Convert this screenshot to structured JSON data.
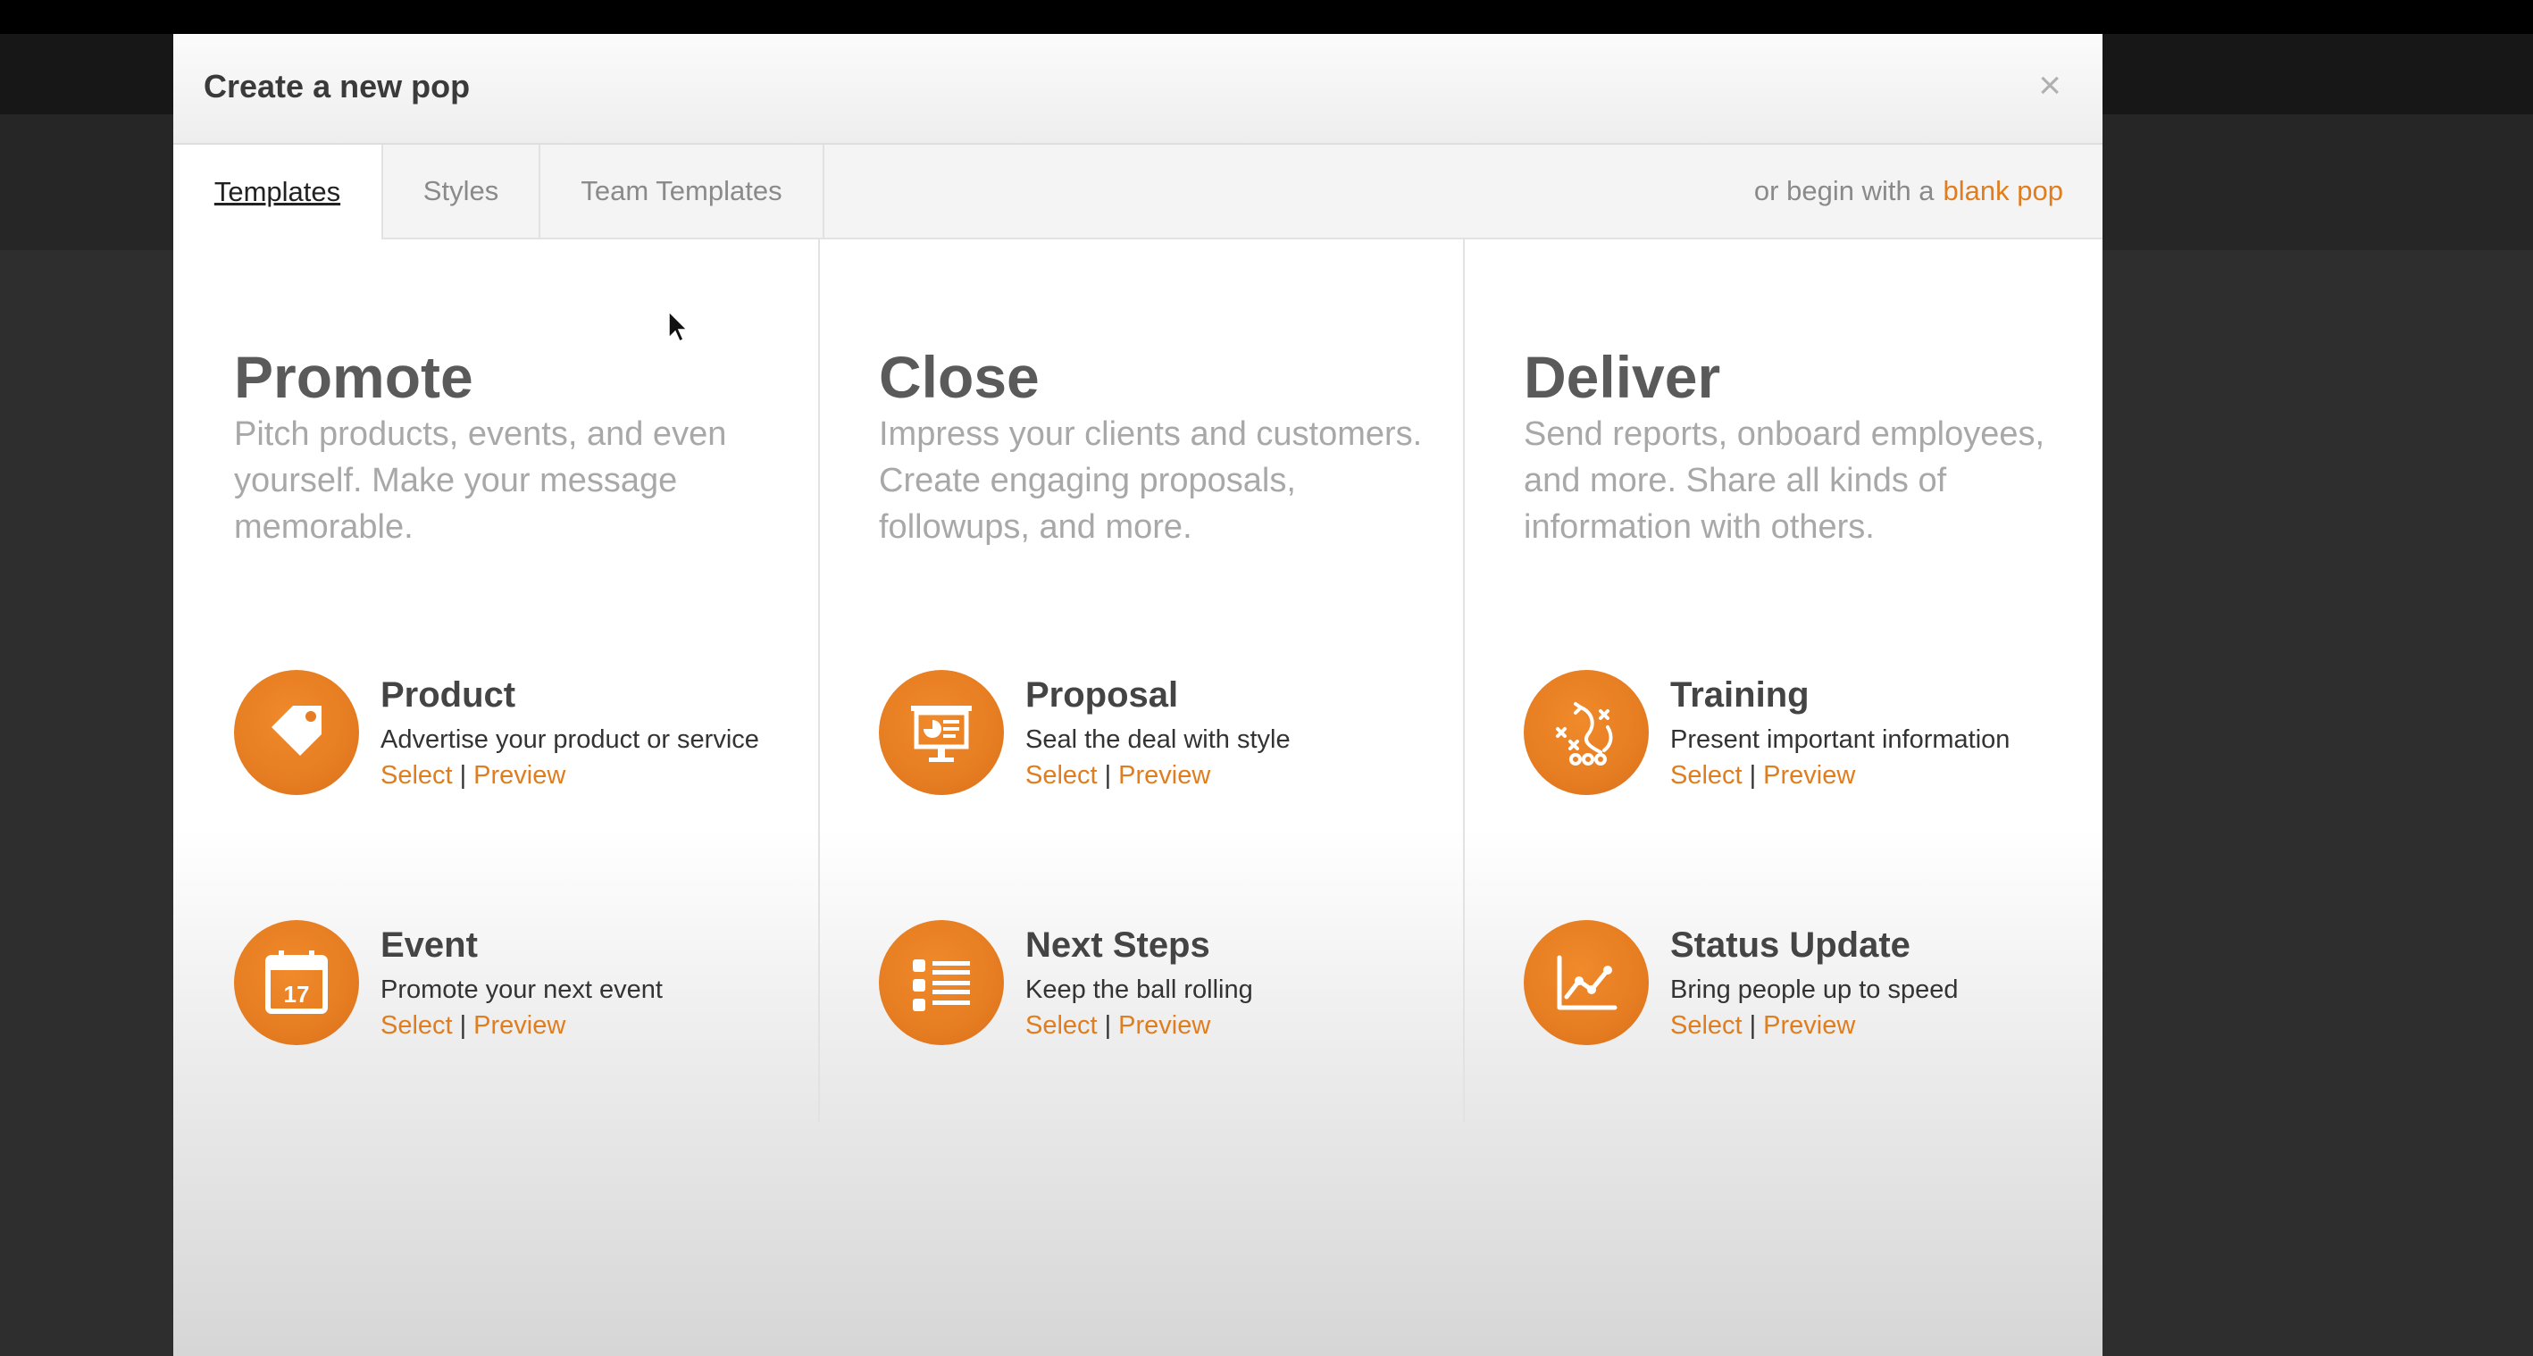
{
  "modal": {
    "title": "Create a new pop",
    "close": "×"
  },
  "tabs": [
    {
      "label": "Templates",
      "active": true
    },
    {
      "label": "Styles",
      "active": false
    },
    {
      "label": "Team Templates",
      "active": false
    }
  ],
  "blank": {
    "prefix": "or begin with a",
    "link": "blank pop"
  },
  "accent_color": "#e67d22",
  "columns": [
    {
      "title": "Promote",
      "description": "Pitch products, events, and even yourself. Make your message memorable.",
      "items": [
        {
          "icon": "tag-icon",
          "title": "Product",
          "desc": "Advertise your product or service",
          "select": "Select",
          "sep": "|",
          "preview": "Preview"
        },
        {
          "icon": "calendar-icon",
          "badge_text": "17",
          "title": "Event",
          "desc": "Promote your next event",
          "select": "Select",
          "sep": "|",
          "preview": "Preview"
        }
      ]
    },
    {
      "title": "Close",
      "description": "Impress your clients and customers. Create engaging proposals, followups, and more.",
      "items": [
        {
          "icon": "presentation-icon",
          "title": "Proposal",
          "desc": "Seal the deal with style",
          "select": "Select",
          "sep": "|",
          "preview": "Preview"
        },
        {
          "icon": "list-icon",
          "title": "Next Steps",
          "desc": "Keep the ball rolling",
          "select": "Select",
          "sep": "|",
          "preview": "Preview"
        }
      ]
    },
    {
      "title": "Deliver",
      "description": "Send reports, onboard employees, and more. Share all kinds of information with others.",
      "items": [
        {
          "icon": "playbook-icon",
          "title": "Training",
          "desc": "Present important information",
          "select": "Select",
          "sep": "|",
          "preview": "Preview"
        },
        {
          "icon": "line-chart-icon",
          "title": "Status Update",
          "desc": "Bring people up to speed",
          "select": "Select",
          "sep": "|",
          "preview": "Preview"
        }
      ]
    }
  ]
}
